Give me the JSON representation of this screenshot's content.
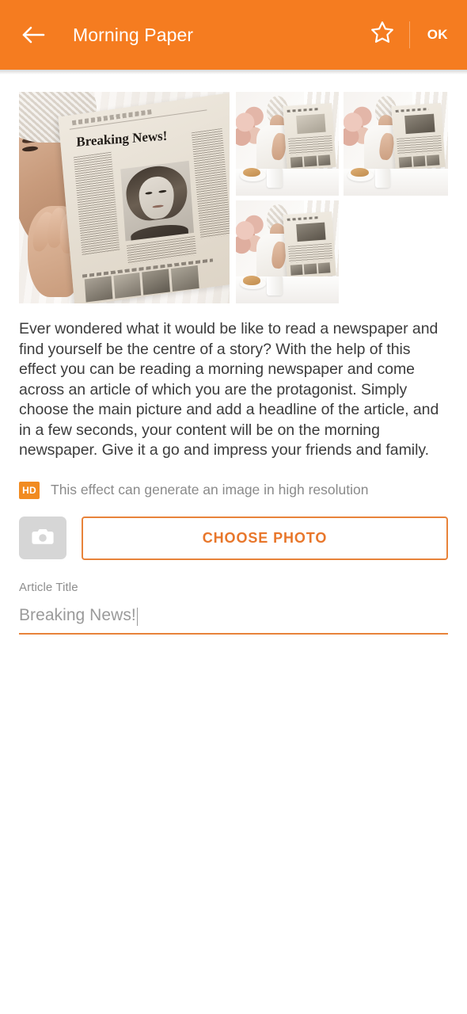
{
  "appbar": {
    "back_icon": "arrow-left-icon",
    "title": "Morning Paper",
    "favorite_icon": "star-outline-icon",
    "ok_label": "OK",
    "background_color": "#F57C20",
    "text_color": "#FFFFFF"
  },
  "gallery": {
    "main_photo_alt": "Woman holding newspaper with Breaking News headline",
    "main_photo_headline": "Breaking News!",
    "thumbnails": [
      {
        "alt": "Woman in bathrobe reading newspaper at breakfast table"
      },
      {
        "alt": "Woman in bathrobe reading newspaper with photo article"
      },
      {
        "alt": "Woman in bathrobe reading newspaper with landscape photo"
      }
    ]
  },
  "description": {
    "text": "Ever wondered what it would be like to read a newspaper and find yourself be the centre of a story? With the help of this effect you can be reading a morning newspaper and come across an article of which you are the protagonist. Simply choose the main picture and add a headline of the article, and in a few seconds, your content will be on the morning newspaper. Give it a go and impress your friends and family."
  },
  "hd_notice": {
    "badge_label": "HD",
    "badge_color": "#F18B21",
    "text": "This effect can generate an image in high resolution"
  },
  "photo_picker": {
    "camera_icon": "camera-icon",
    "choose_label": "CHOOSE PHOTO",
    "accent_color": "#E8762A"
  },
  "article_field": {
    "label": "Article Title",
    "value": "Breaking News!",
    "placeholder": "Breaking News!",
    "underline_color": "#E8833A"
  }
}
